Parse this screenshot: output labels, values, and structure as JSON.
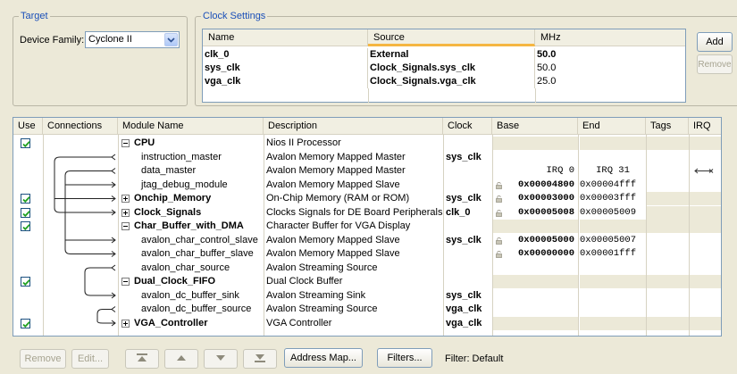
{
  "target": {
    "legend": "Target",
    "device_family_label": "Device Family:",
    "device_family_value": "Cyclone II"
  },
  "clock_settings": {
    "legend": "Clock Settings",
    "columns": [
      "Name",
      "Source",
      "MHz"
    ],
    "rows": [
      {
        "name": "clk_0",
        "source": "External",
        "mhz": "50.0"
      },
      {
        "name": "sys_clk",
        "source": "Clock_Signals.sys_clk",
        "mhz": "50.0"
      },
      {
        "name": "vga_clk",
        "source": "Clock_Signals.vga_clk",
        "mhz": "25.0"
      }
    ],
    "add_label": "Add",
    "remove_label": "Remove"
  },
  "modules": {
    "columns": [
      "Use",
      "Connections",
      "Module Name",
      "Description",
      "Clock",
      "Base",
      "End",
      "Tags",
      "IRQ"
    ],
    "rows": [
      {
        "use": true,
        "name": "CPU",
        "toggle": "minus",
        "child": false,
        "desc": "Nios II Processor",
        "clock": "",
        "base": "",
        "end": ""
      },
      {
        "use": null,
        "name": "instruction_master",
        "child": true,
        "desc": "Avalon Memory Mapped Master",
        "clock": "sys_clk",
        "base": "",
        "end": ""
      },
      {
        "use": null,
        "name": "data_master",
        "child": true,
        "desc": "Avalon Memory Mapped Master",
        "clock": "",
        "base": "IRQ 0",
        "end": "IRQ 31",
        "irq_arrow": true
      },
      {
        "use": null,
        "name": "jtag_debug_module",
        "child": true,
        "desc": "Avalon Memory Mapped Slave",
        "clock": "",
        "base": "0x00004800",
        "end": "0x00004fff",
        "lock": true
      },
      {
        "use": true,
        "name": "Onchip_Memory",
        "toggle": "plus",
        "child": false,
        "desc": "On-Chip Memory (RAM or ROM)",
        "clock": "sys_clk",
        "base": "0x00003000",
        "end": "0x00003fff",
        "lock": true
      },
      {
        "use": true,
        "name": "Clock_Signals",
        "toggle": "plus",
        "child": false,
        "desc": "Clocks Signals for DE Board Peripherals",
        "clock": "clk_0",
        "base": "0x00005008",
        "end": "0x00005009",
        "lock": true
      },
      {
        "use": true,
        "name": "Char_Buffer_with_DMA",
        "toggle": "minus",
        "child": false,
        "desc": "Character Buffer for VGA Display",
        "clock": "",
        "base": "",
        "end": ""
      },
      {
        "use": null,
        "name": "avalon_char_control_slave",
        "child": true,
        "desc": "Avalon Memory Mapped Slave",
        "clock": "sys_clk",
        "base": "0x00005000",
        "end": "0x00005007",
        "lock": true
      },
      {
        "use": null,
        "name": "avalon_char_buffer_slave",
        "child": true,
        "desc": "Avalon Memory Mapped Slave",
        "clock": "",
        "base": "0x00000000",
        "end": "0x00001fff",
        "lock": true
      },
      {
        "use": null,
        "name": "avalon_char_source",
        "child": true,
        "desc": "Avalon Streaming Source",
        "clock": "",
        "base": "",
        "end": ""
      },
      {
        "use": true,
        "name": "Dual_Clock_FIFO",
        "toggle": "minus",
        "child": false,
        "desc": "Dual Clock Buffer",
        "clock": "",
        "base": "",
        "end": ""
      },
      {
        "use": null,
        "name": "avalon_dc_buffer_sink",
        "child": true,
        "desc": "Avalon Streaming Sink",
        "clock": "sys_clk",
        "base": "",
        "end": ""
      },
      {
        "use": null,
        "name": "avalon_dc_buffer_source",
        "child": true,
        "desc": "Avalon Streaming Source",
        "clock": "vga_clk",
        "base": "",
        "end": ""
      },
      {
        "use": true,
        "name": "VGA_Controller",
        "toggle": "plus",
        "child": false,
        "desc": "VGA Controller",
        "clock": "vga_clk",
        "base": "",
        "end": ""
      }
    ]
  },
  "toolbar": {
    "remove_label": "Remove",
    "edit_label": "Edit...",
    "address_map_label": "Address Map...",
    "filters_label": "Filters...",
    "filter_status": "Filter: Default"
  },
  "colors": {
    "accent": "#1a4fb8",
    "grid_line": "#d6d2c2",
    "panel_bg": "#ece9d8"
  }
}
